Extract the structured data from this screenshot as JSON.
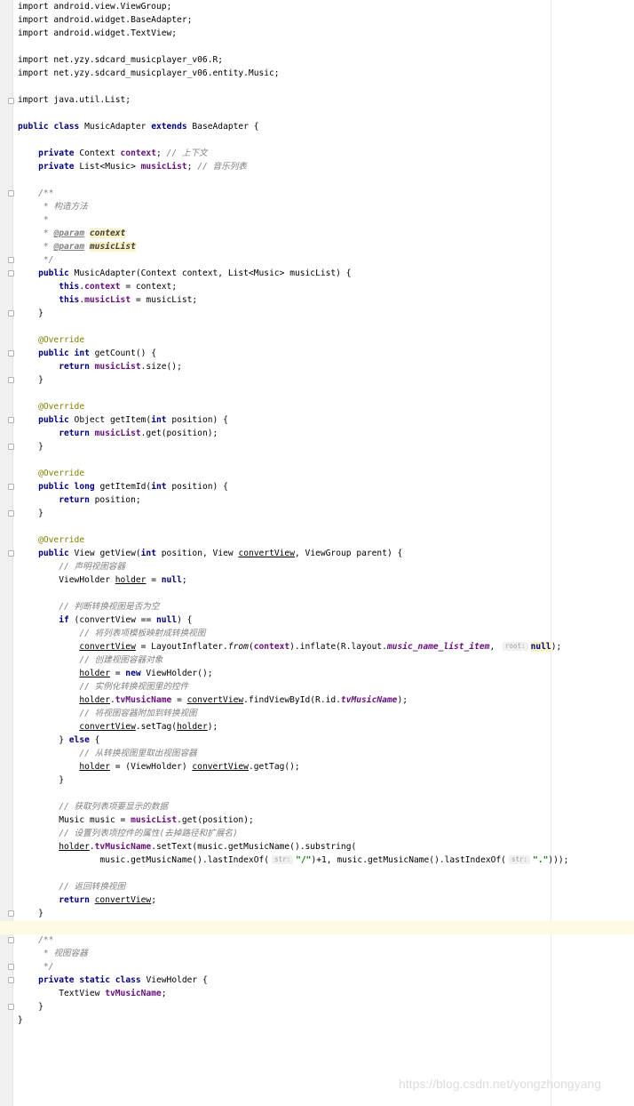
{
  "editor": {
    "watermark": "https://blog.csdn.net/yongzhongyang"
  },
  "code": {
    "l01": "import android.view.ViewGroup;",
    "l02": "import android.widget.BaseAdapter;",
    "l03": "import android.widget.TextView;",
    "l04": "import net.yzy.sdcard_musicplayer_v06.R;",
    "l05": "import net.yzy.sdcard_musicplayer_v06.entity.Music;",
    "l06": "import java.util.List;",
    "kw_import": "import",
    "kw_public": "public",
    "kw_private": "private",
    "kw_class": "class",
    "kw_extends": "extends",
    "kw_static": "static",
    "kw_return": "return",
    "kw_this": "this",
    "kw_int": "int",
    "kw_long": "long",
    "kw_new": "new",
    "kw_if": "if",
    "kw_else": "else",
    "kw_null": "null",
    "class_name": "MusicAdapter",
    "base_class": "BaseAdapter",
    "type_context": "Context",
    "type_list_music": "List<Music>",
    "type_object": "Object",
    "type_view": "View",
    "type_viewgroup": "ViewGroup",
    "type_viewholder": "ViewHolder",
    "type_textview": "TextView",
    "type_music": "Music",
    "f_context": "context",
    "f_musicList": "musicList",
    "f_tvMusicName": "tvMusicName",
    "c_context": "// 上下文",
    "c_musicList": "// 音乐列表",
    "jd_open": "/**",
    "jd_ctor": "* 构造方法",
    "jd_star": "*",
    "jd_param": "@param",
    "jd_close": "*/",
    "ann_override": "@Override",
    "m_getCount": "getCount",
    "m_getItem": "getItem",
    "m_getItemId": "getItemId",
    "m_getView": "getView",
    "v_position": "position",
    "v_convertView": "convertView",
    "v_parent": "parent",
    "v_holder": "holder",
    "v_music": "music",
    "c_decl_holder": "// 声明视图容器",
    "c_check_convert": "// 判断转换视图是否为空",
    "c_inflate": "// 将列表项模板映射成转换视图",
    "c_create_holder": "// 创建视图容器对象",
    "c_init_ctrl": "// 实例化转换视图里的控件",
    "c_attach_holder": "// 将视图容器附加到转换视图",
    "c_get_holder": "// 从转换视图里取出视图容器",
    "c_get_data": "// 获取列表项要显示的数据",
    "c_set_attr": "// 设置列表项控件的属性(去掉路径和扩展名)",
    "c_return_view": "// 返回转换视图",
    "jd_holder": "* 视图容器",
    "layout_item": "music_name_list_item",
    "hint_root": "root:",
    "hint_str": "str:",
    "s_slash": "\"/\"",
    "s_dot": "\".\""
  }
}
